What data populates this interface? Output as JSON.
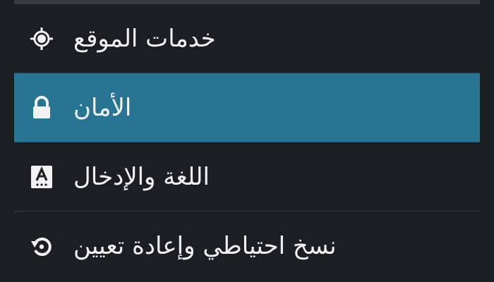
{
  "settings": {
    "items": [
      {
        "label": "خدمات الموقع",
        "icon": "location-target-icon",
        "selected": false
      },
      {
        "label": "الأمان",
        "icon": "lock-icon",
        "selected": true
      },
      {
        "label": "اللغة والإدخال",
        "icon": "language-keyboard-icon",
        "selected": false
      },
      {
        "label": "نسخ احتياطي وإعادة تعيين",
        "icon": "backup-restore-icon",
        "selected": false
      }
    ]
  },
  "colors": {
    "background": "#1d1e22",
    "selected": "#287493",
    "text": "#f2f2f2",
    "divider": "#38393d"
  }
}
